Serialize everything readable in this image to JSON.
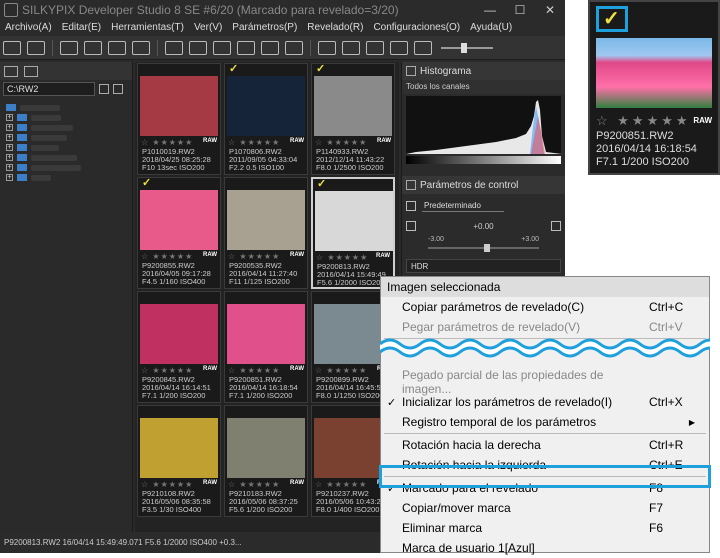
{
  "title": "SILKYPIX Developer Studio 8 SE   #6/20 (Marcado para revelado=3/20)",
  "window_controls": [
    "—",
    "☐",
    "✕"
  ],
  "menu": [
    "Archivo(A)",
    "Editar(E)",
    "Herramientas(T)",
    "Ver(V)",
    "Parámetros(P)",
    "Revelado(R)",
    "Configuraciones(O)",
    "Ayuda(U)"
  ],
  "path": "C:\\RW2",
  "tree_toggle": "+",
  "thumbnails": [
    {
      "name": "P1010019.RW2",
      "date": "2018/04/25 08:25:28",
      "info": "F10 13sec ISO200",
      "checked": false,
      "selected": false
    },
    {
      "name": "P1070806.RW2",
      "date": "2011/09/05 04:33:04",
      "info": "F2.2 0.5 ISO100",
      "checked": true,
      "selected": false
    },
    {
      "name": "P1140933.RW2",
      "date": "2012/12/14 11:43:22",
      "info": "F8.0 1/2500 ISO200",
      "checked": true,
      "selected": false
    },
    {
      "name": "P9200855.RW2",
      "date": "2016/04/05 09:17:28",
      "info": "F4.5 1/160 ISO400",
      "checked": true,
      "selected": false
    },
    {
      "name": "P9200535.RW2",
      "date": "2016/04/14 11:27:40",
      "info": "F11 1/125 ISO200",
      "checked": false,
      "selected": false
    },
    {
      "name": "P9200813.RW2",
      "date": "2016/04/14 15:49:49",
      "info": "F5.6 1/2000 ISO200",
      "checked": true,
      "selected": true
    },
    {
      "name": "P9200845.RW2",
      "date": "2016/04/14 16:14:51",
      "info": "F7.1 1/200 ISO200",
      "checked": false,
      "selected": false
    },
    {
      "name": "P9200851.RW2",
      "date": "2016/04/14 16:18:54",
      "info": "F7.1 1/200 ISO200",
      "checked": false,
      "selected": false
    },
    {
      "name": "P9200899.RW2",
      "date": "2016/04/14 16:45:51",
      "info": "F8.0 1/1250 ISO200",
      "checked": false,
      "selected": false
    },
    {
      "name": "P9210108.RW2",
      "date": "2016/05/06 08:35:58",
      "info": "F3.5 1/30 ISO400",
      "checked": false,
      "selected": false
    },
    {
      "name": "P9210183.RW2",
      "date": "2016/05/06 08:37:25",
      "info": "F5.6 1/200 ISO200",
      "checked": false,
      "selected": false
    },
    {
      "name": "P9210237.RW2",
      "date": "2016/05/06 10:43:28",
      "info": "F8.0 1/400 ISO200",
      "checked": false,
      "selected": false
    }
  ],
  "thumb_colors": [
    "#a63a44",
    "#16243a",
    "#8a8a8a",
    "#e85a8a",
    "#a8a090",
    "#d8d8d8",
    "#c03060",
    "#e0508a",
    "#7a8a90",
    "#c0a030",
    "#808070",
    "#7a4030"
  ],
  "stars": "☆ ★★★★★",
  "raw_badge": "RAW",
  "check_mark": "✓",
  "histogram": {
    "title": "Histograma",
    "channel": "Todos los canales"
  },
  "control": {
    "title": "Parámetros de control",
    "preset": "Predeterminado",
    "value": "+0.00",
    "min": "-3.00",
    "max": "+3.00",
    "hdr": "HDR"
  },
  "status": "P9200813.RW2 16/04/14 15:49:49.071 F5.6 1/2000 ISO400 +0.3...",
  "context_menu": {
    "header": "Imagen seleccionada",
    "items": [
      {
        "label": "Copiar parámetros de revelado(C)",
        "shortcut": "Ctrl+C",
        "disabled": false,
        "checked": false
      },
      {
        "label": "Pegar parámetros de revelado(V)",
        "shortcut": "Ctrl+V",
        "disabled": true,
        "checked": false
      },
      {
        "label": "Pegado parcial de las propiedades de imagen...",
        "shortcut": "",
        "disabled": true,
        "checked": false
      },
      {
        "label": "Inicializar los parámetros de revelado(I)",
        "shortcut": "Ctrl+X",
        "disabled": false,
        "checked": true
      },
      {
        "label": "Registro temporal de los parámetros",
        "shortcut": "",
        "disabled": false,
        "checked": false,
        "submenu": true
      },
      {
        "label": "Rotación hacia la derecha",
        "shortcut": "Ctrl+R",
        "disabled": false,
        "checked": false
      },
      {
        "label": "Rotación hacia la izquierda",
        "shortcut": "Ctrl+E",
        "disabled": false,
        "checked": false
      },
      {
        "label": "Marcado para el revelado",
        "shortcut": "F8",
        "disabled": false,
        "checked": true
      },
      {
        "label": "Copiar/mover marca",
        "shortcut": "F7",
        "disabled": false,
        "checked": false
      },
      {
        "label": "Eliminar marca",
        "shortcut": "F6",
        "disabled": false,
        "checked": false
      },
      {
        "label": "Marca de usuario 1[Azul]",
        "shortcut": "",
        "disabled": false,
        "checked": false
      }
    ]
  },
  "zoom": {
    "name": "P9200851.RW2",
    "date": "2016/04/14 16:18:54",
    "info": "F7.1 1/200 ISO200"
  },
  "accent": "#1ea0dc",
  "check_color": "#f0e040"
}
